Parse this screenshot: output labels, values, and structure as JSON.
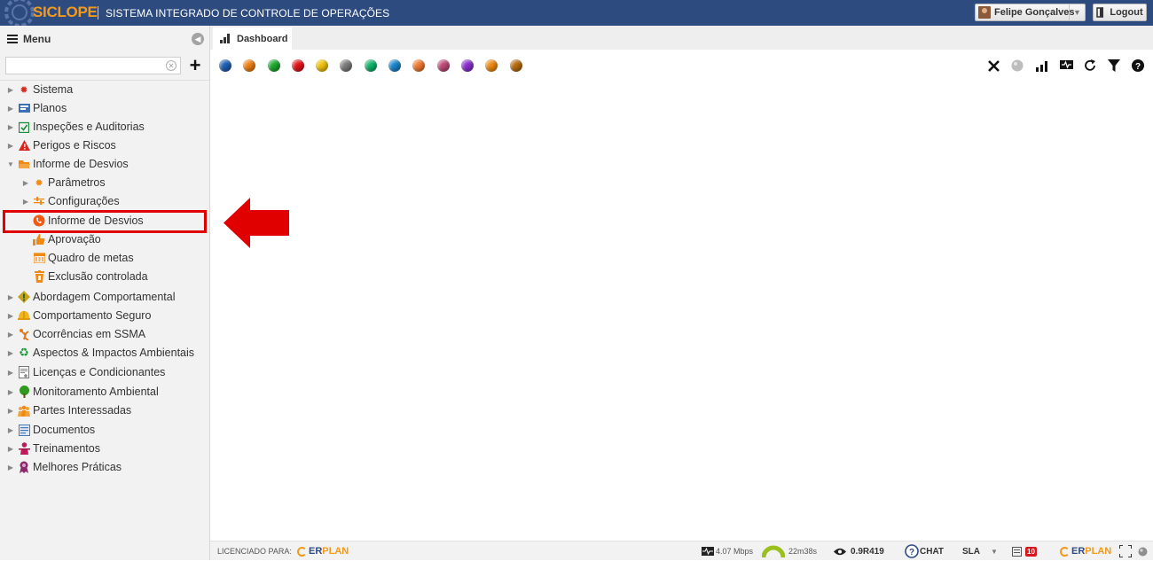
{
  "app": {
    "logo": "SICLOPE",
    "title": "SISTEMA INTEGRADO DE CONTROLE DE OPERAÇÕES"
  },
  "header": {
    "user_name": "Felipe Gonçalves",
    "logout_label": "Logout"
  },
  "sidebar": {
    "menu_label": "Menu",
    "search_placeholder": "",
    "items": [
      {
        "label": "Sistema",
        "icon": "gear-icon",
        "expanded": false
      },
      {
        "label": "Planos",
        "icon": "plans-icon",
        "expanded": false
      },
      {
        "label": "Inspeções e Auditorias",
        "icon": "checklist-icon",
        "expanded": false
      },
      {
        "label": "Perigos e Riscos",
        "icon": "warning-icon",
        "expanded": false
      },
      {
        "label": "Informe de Desvios",
        "icon": "folder-open-icon",
        "expanded": true
      },
      {
        "label": "Parâmetros",
        "icon": "gear-icon",
        "expanded": false
      },
      {
        "label": "Configurações",
        "icon": "sliders-icon",
        "expanded": false
      },
      {
        "label": "Informe de Desvios",
        "icon": "phone-bubble-icon",
        "selected": true
      },
      {
        "label": "Aprovação",
        "icon": "thumbs-up-icon"
      },
      {
        "label": "Quadro de metas",
        "icon": "calendar-icon"
      },
      {
        "label": "Exclusão controlada",
        "icon": "trash-icon"
      },
      {
        "label": "Abordagem Comportamental",
        "icon": "diamond-icon",
        "expanded": false
      },
      {
        "label": "Comportamento Seguro",
        "icon": "helmet-icon",
        "expanded": false
      },
      {
        "label": "Ocorrências em SSMA",
        "icon": "falling-person-icon",
        "expanded": false
      },
      {
        "label": "Aspectos & Impactos Ambientais",
        "icon": "recycle-icon",
        "expanded": false
      },
      {
        "label": "Licenças e Condicionantes",
        "icon": "certificate-icon",
        "expanded": false
      },
      {
        "label": "Monitoramento Ambiental",
        "icon": "tree-icon",
        "expanded": false
      },
      {
        "label": "Partes Interessadas",
        "icon": "people-icon",
        "expanded": false
      },
      {
        "label": "Documentos",
        "icon": "document-icon",
        "expanded": false
      },
      {
        "label": "Treinamentos",
        "icon": "teacher-icon",
        "expanded": false
      },
      {
        "label": "Melhores Práticas",
        "icon": "award-icon",
        "expanded": false
      }
    ]
  },
  "tabs": [
    {
      "label": "Dashboard",
      "icon": "bar-chart-icon",
      "active": true
    }
  ],
  "color_dots": [
    "#1f5fb5",
    "#f07f12",
    "#1bab2d",
    "#e5141b",
    "#f2c40a",
    "#7d7d7d",
    "#13b46b",
    "#1a86cf",
    "#f27a32",
    "#c04a79",
    "#8a2fd0",
    "#f08a12",
    "#b86c10"
  ],
  "toolbar_icons": [
    "close-icon",
    "gray-dot-icon",
    "bar-chart-icon",
    "monitor-icon",
    "refresh-icon",
    "filter-icon",
    "help-icon"
  ],
  "footer": {
    "licensed_label": "LICENCIADO PARA:",
    "brand_er": "ER",
    "brand_plan": "PLAN",
    "speed": "4.07 Mbps",
    "session_time": "22m38s",
    "version": "0.9R419",
    "chat_label": "CHAT",
    "sla_label": "SLA",
    "notification_count": "10"
  },
  "colors": {
    "topbar": "#2e4b80",
    "logo": "#f29a1c",
    "highlight": "#e00000"
  }
}
